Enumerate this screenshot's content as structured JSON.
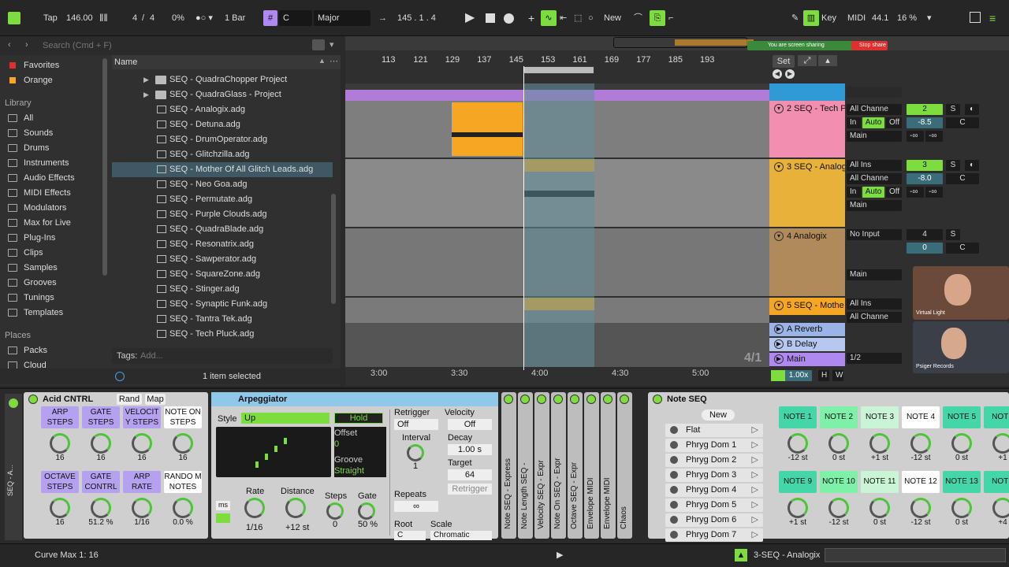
{
  "colors": {
    "green": "#7ddc3e",
    "purple": "#b089f0",
    "orange": "#f5a623",
    "teal": "#5e8f9a",
    "pink": "#f28eb0"
  },
  "topbar": {
    "tap": "Tap",
    "tempo": "146.00",
    "sig_num": "4",
    "sig_sep": "/",
    "sig_den": "4",
    "swing": "0%",
    "quant": "1 Bar",
    "key_label": "C",
    "scale": "Major",
    "position": "145 .   1 .   4",
    "new_label": "New",
    "key_btn": "Key",
    "midi_btn": "MIDI",
    "sample_rate": "44.1",
    "cpu": "16 %"
  },
  "browser": {
    "search_placeholder": "Search (Cmd + F)",
    "name_header": "Name",
    "collections": [
      {
        "label": "Favorites",
        "color": "#e0302e"
      },
      {
        "label": "Orange",
        "color": "#f5a623"
      }
    ],
    "library_title": "Library",
    "library": [
      "All",
      "Sounds",
      "Drums",
      "Instruments",
      "Audio Effects",
      "MIDI Effects",
      "Modulators",
      "Max for Live",
      "Plug-Ins",
      "Clips",
      "Samples",
      "Grooves",
      "Tunings",
      "Templates"
    ],
    "places_title": "Places",
    "places": [
      "Packs",
      "Cloud"
    ],
    "folders": [
      "SEQ - QuadraChopper Project",
      "SEQ - QuadraGlass - Project"
    ],
    "files": [
      "SEQ - Analogix.adg",
      "SEQ - Detuna.adg",
      "SEQ - DrumOperator.adg",
      "SEQ - Glitchzilla.adg",
      "SEQ - Mother Of All Glitch Leads.adg",
      "SEQ - Neo Goa.adg",
      "SEQ - Permutate.adg",
      "SEQ - Purple Clouds.adg",
      "SEQ - QuadraBlade.adg",
      "SEQ - Resonatrix.adg",
      "SEQ - Sawperator.adg",
      "SEQ - SquareZone.adg",
      "SEQ - Stinger.adg",
      "SEQ - Synaptic Funk.adg",
      "SEQ - Tantra Tek.adg",
      "SEQ - Tech Pluck.adg"
    ],
    "tags_label": "Tags:",
    "tags_placeholder": "Add...",
    "status": "1 item selected"
  },
  "arrangement": {
    "bars": [
      "113",
      "121",
      "129",
      "137",
      "145",
      "153",
      "161",
      "169",
      "177",
      "185",
      "193"
    ],
    "set_label": "Set",
    "time": [
      "3:00",
      "3:30",
      "4:00",
      "4:30",
      "5:00"
    ],
    "sig": "4/1",
    "zoom": "1.00x",
    "h": "H",
    "w": "W",
    "share_text": "You are screen sharing",
    "stop_share": "Stop share",
    "tracks": [
      {
        "name": "2 SEQ - Tech Pl",
        "color": "#f28eb0",
        "input": "All Channe",
        "num": "2",
        "vol": "-8.5",
        "pan": "C",
        "out": "Main"
      },
      {
        "name": "3 SEQ - Analog",
        "color": "#e8b13a",
        "input": "All Ins",
        "chan": "All Channe",
        "num": "3",
        "vol": "-8.0",
        "pan": "C",
        "out": "Main"
      },
      {
        "name": "4 Analogix",
        "color": "#b08a5a",
        "input": "No Input",
        "num": "4",
        "vol": "0",
        "pan": "C",
        "out": "Main"
      },
      {
        "name": "5 SEQ - Mothe",
        "color": "#f5a623",
        "input": "All Ins",
        "chan": "All Channe"
      }
    ],
    "returns": [
      "A Reverb",
      "B Delay",
      "Main"
    ],
    "main_quant": "1/2",
    "in": "In",
    "auto": "Auto",
    "off": "Off",
    "solo": "S",
    "inf": "-∞",
    "cam_label1": "Virtual Light",
    "cam_label2": "Psiger Records"
  },
  "acid": {
    "title": "Acid CNTRL",
    "rand": "Rand",
    "map": "Map",
    "row1": [
      {
        "label": "ARP STEPS",
        "val": "16"
      },
      {
        "label": "GATE STEPS",
        "val": "16"
      },
      {
        "label": "VELOCIT Y STEPS",
        "val": "16"
      },
      {
        "label": "NOTE ON STEPS",
        "val": "16"
      }
    ],
    "row2": [
      {
        "label": "OCTAVE STEPS",
        "val": "16"
      },
      {
        "label": "GATE CONTRL",
        "val": "51.2 %"
      },
      {
        "label": "ARP RATE",
        "val": "1/16"
      },
      {
        "label": "RANDO M NOTES",
        "val": "0.0 %"
      }
    ]
  },
  "arp": {
    "title": "Arpeggiator",
    "style_label": "Style",
    "style": "Up",
    "hold": "Hold",
    "offset_label": "Offset",
    "offset": "0",
    "groove_label": "Groove",
    "groove": "Straight",
    "ms": "ms",
    "rate_label": "Rate",
    "rate": "1/16",
    "distance_label": "Distance",
    "distance": "+12 st",
    "steps_label": "Steps",
    "steps": "0",
    "gate_label": "Gate",
    "gate": "50 %",
    "retrig_label": "Retrigger",
    "retrig": "Off",
    "interval_label": "Interval",
    "interval": "1",
    "repeats_label": "Repeats",
    "repeats": "∞",
    "velocity_label": "Velocity",
    "velocity": "Off",
    "decay_label": "Decay",
    "decay": "1.00 s",
    "target_label": "Target",
    "target": "64",
    "retrigger_btn": "Retrigger",
    "root_label": "Root",
    "root": "C",
    "scale_label": "Scale",
    "scale": "Chromatic"
  },
  "chain": [
    "Note SEQ - Express",
    "Note Length SEQ -",
    "Velocity SEQ - Expr",
    "Note On SEQ - Expr",
    "Octave SEQ - Expr",
    "Envelope MIDI",
    "Envelope MIDI",
    "Chaos"
  ],
  "noteseq": {
    "title": "Note SEQ",
    "new": "New",
    "presets": [
      "Flat",
      "Phryg Dom 1",
      "Phryg Dom 2",
      "Phryg Dom 3",
      "Phryg Dom 4",
      "Phryg Dom 5",
      "Phryg Dom 6",
      "Phryg Dom 7"
    ],
    "row1": [
      {
        "label": "NOTE 1",
        "val": "-12 st"
      },
      {
        "label": "NOTE 2",
        "val": "0 st"
      },
      {
        "label": "NOTE 3",
        "val": "+1 st"
      },
      {
        "label": "NOTE 4",
        "val": "-12 st"
      },
      {
        "label": "NOTE 5",
        "val": "0 st"
      },
      {
        "label": "NOTE",
        "val": "+1"
      }
    ],
    "row2": [
      {
        "label": "NOTE 9",
        "val": "+1 st"
      },
      {
        "label": "NOTE 10",
        "val": "-12 st"
      },
      {
        "label": "NOTE 11",
        "val": "0 st"
      },
      {
        "label": "NOTE 12",
        "val": "-12 st"
      },
      {
        "label": "NOTE 13",
        "val": "0 st"
      },
      {
        "label": "NOTE",
        "val": "+4"
      }
    ]
  },
  "status": {
    "text": "Curve Max 1: 16",
    "track": "3-SEQ - Analogix"
  }
}
